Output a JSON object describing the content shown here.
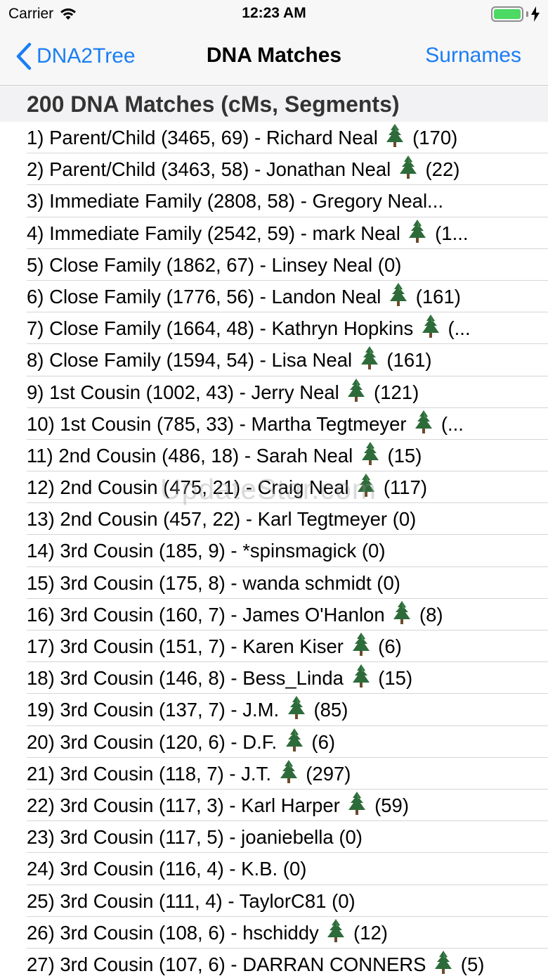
{
  "status": {
    "carrier": "Carrier",
    "time": "12:23 AM",
    "battery_color": "#4cd964"
  },
  "nav": {
    "back_label": "DNA2Tree",
    "title": "DNA Matches",
    "right_label": "Surnames",
    "accent": "#1a7ef5"
  },
  "section": {
    "header": "200 DNA Matches (cMs, Segments)"
  },
  "watermark": "UpdateStar.com",
  "matches": [
    {
      "prefix": "1) Parent/Child (3465, 69) - Richard Neal ",
      "tree": true,
      "suffix": " (170)"
    },
    {
      "prefix": "2) Parent/Child (3463, 58) - Jonathan Neal ",
      "tree": true,
      "suffix": " (22)"
    },
    {
      "prefix": "3) Immediate Family (2808, 58) - Gregory Neal...",
      "tree": false,
      "suffix": ""
    },
    {
      "prefix": "4) Immediate Family (2542, 59) - mark Neal ",
      "tree": true,
      "suffix": " (1..."
    },
    {
      "prefix": "5) Close Family (1862, 67) - Linsey Neal  (0)",
      "tree": false,
      "suffix": ""
    },
    {
      "prefix": "6) Close Family (1776, 56) - Landon Neal ",
      "tree": true,
      "suffix": " (161)"
    },
    {
      "prefix": "7) Close Family (1664, 48) - Kathryn Hopkins ",
      "tree": true,
      "suffix": " (..."
    },
    {
      "prefix": "8) Close Family (1594, 54) - Lisa Neal ",
      "tree": true,
      "suffix": " (161)"
    },
    {
      "prefix": "9) 1st Cousin (1002, 43) - Jerry Neal ",
      "tree": true,
      "suffix": " (121)"
    },
    {
      "prefix": "10) 1st Cousin (785, 33) - Martha Tegtmeyer ",
      "tree": true,
      "suffix": " (..."
    },
    {
      "prefix": "11) 2nd Cousin (486, 18) - Sarah Neal ",
      "tree": true,
      "suffix": " (15)"
    },
    {
      "prefix": "12) 2nd Cousin (475, 21) - Craig Neal ",
      "tree": true,
      "suffix": " (117)"
    },
    {
      "prefix": "13) 2nd Cousin (457, 22) - Karl Tegtmeyer  (0)",
      "tree": false,
      "suffix": ""
    },
    {
      "prefix": "14) 3rd Cousin (185, 9) - *spinsmagick  (0)",
      "tree": false,
      "suffix": ""
    },
    {
      "prefix": "15) 3rd Cousin (175, 8) - wanda schmidt  (0)",
      "tree": false,
      "suffix": ""
    },
    {
      "prefix": "16) 3rd Cousin (160, 7) - James O'Hanlon ",
      "tree": true,
      "suffix": " (8)"
    },
    {
      "prefix": "17) 3rd Cousin (151, 7) - Karen Kiser ",
      "tree": true,
      "suffix": " (6)"
    },
    {
      "prefix": "18) 3rd Cousin (146, 8) - Bess_Linda ",
      "tree": true,
      "suffix": " (15)"
    },
    {
      "prefix": "19) 3rd Cousin (137, 7) - J.M. ",
      "tree": true,
      "suffix": " (85)"
    },
    {
      "prefix": "20) 3rd Cousin (120, 6) - D.F. ",
      "tree": true,
      "suffix": " (6)"
    },
    {
      "prefix": "21) 3rd Cousin (118, 7) - J.T. ",
      "tree": true,
      "suffix": " (297)"
    },
    {
      "prefix": "22) 3rd Cousin (117, 3) - Karl Harper ",
      "tree": true,
      "suffix": " (59)"
    },
    {
      "prefix": "23) 3rd Cousin (117, 5) - joaniebella  (0)",
      "tree": false,
      "suffix": ""
    },
    {
      "prefix": "24) 3rd Cousin (116, 4) - K.B.  (0)",
      "tree": false,
      "suffix": ""
    },
    {
      "prefix": "25) 3rd Cousin (111, 4) - TaylorC81  (0)",
      "tree": false,
      "suffix": ""
    },
    {
      "prefix": "26) 3rd Cousin (108, 6) - hschiddy ",
      "tree": true,
      "suffix": " (12)"
    },
    {
      "prefix": "27) 3rd Cousin (107, 6) - DARRAN CONNERS ",
      "tree": true,
      "suffix": " (5)"
    }
  ]
}
